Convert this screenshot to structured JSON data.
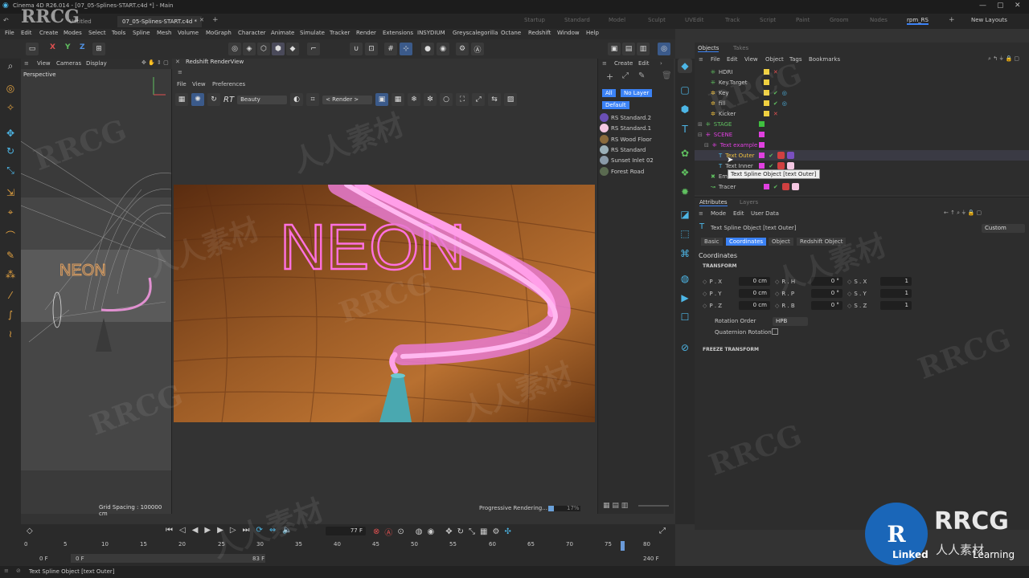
{
  "titlebar": {
    "title": "Cinema 4D R26.014 - [07_05-Splines-START.c4d *] - Main"
  },
  "file_tabs": [
    "Untitled",
    "07_05-Splines-START.c4d *"
  ],
  "layouts": [
    "Startup",
    "Standard",
    "Model",
    "Sculpt",
    "UVEdit",
    "Track",
    "Script",
    "Paint",
    "Groom",
    "Nodes",
    "rpm_RS"
  ],
  "new_layouts": "New Layouts",
  "menus": [
    "File",
    "Edit",
    "Create",
    "Modes",
    "Select",
    "Tools",
    "Spline",
    "Mesh",
    "Volume",
    "MoGraph",
    "Character",
    "Animate",
    "Simulate",
    "Tracker",
    "Render",
    "Extensions",
    "INSYDIUM",
    "Greyscalegorilla",
    "Octane",
    "Redshift",
    "Window",
    "Help"
  ],
  "axis": {
    "x": "X",
    "y": "Y",
    "z": "Z"
  },
  "viewport": {
    "menu": [
      "View",
      "Cameras",
      "Display"
    ],
    "label": "Perspective",
    "grid": "Grid Spacing : 100000 cm"
  },
  "renderview": {
    "title": "Redshift RenderView",
    "menu": [
      "File",
      "View",
      "Preferences"
    ],
    "rt": "RT",
    "aov": "Beauty",
    "render_dd": "< Render >",
    "neon_text": "NEON",
    "progress": "Progressive Rendering...",
    "progress_pct": "17%"
  },
  "materials": {
    "menu": [
      "Create",
      "Edit"
    ],
    "filters": [
      "All",
      "No Layer"
    ],
    "default_btn": "Default",
    "items": [
      {
        "name": "RS Standard.2",
        "color": "#6a4fb5"
      },
      {
        "name": "RS Standard.1",
        "color": "#f4c7e2"
      },
      {
        "name": "RS Wood Floor",
        "color": "#8a6a3c"
      },
      {
        "name": "RS Standard",
        "color": "#9bb0b8"
      },
      {
        "name": "Sunset Inlet 02",
        "color": "#8a9aa8"
      },
      {
        "name": "Forest Road",
        "color": "#5a6a50"
      }
    ]
  },
  "objects": {
    "tabs": [
      "Objects",
      "Takes"
    ],
    "menu": [
      "File",
      "Edit",
      "View",
      "Object",
      "Tags",
      "Bookmarks"
    ],
    "rows": [
      {
        "name": "HDRI",
        "color": "#f0d040",
        "indent": 0
      },
      {
        "name": "Key.Target",
        "color": "#f0d040",
        "indent": 0
      },
      {
        "name": "Key",
        "color": "#f0d040",
        "indent": 0
      },
      {
        "name": "fill",
        "color": "#f0d040",
        "indent": 0
      },
      {
        "name": "Kicker",
        "color": "#f0d040",
        "indent": 0
      },
      {
        "name": "STAGE",
        "color": "#40c040",
        "indent": 0
      },
      {
        "name": "SCENE",
        "color": "#e040e0",
        "indent": 0
      },
      {
        "name": "Text example",
        "color": "#e040e0",
        "indent": 1
      },
      {
        "name": "Text Outer",
        "color": "#e040e0",
        "indent": 2
      },
      {
        "name": "Text Inner",
        "color": "#e040e0",
        "indent": 2
      },
      {
        "name": "Emitter",
        "color": "#e040e0",
        "indent": 1
      },
      {
        "name": "Tracer",
        "color": "#e040e0",
        "indent": 1
      }
    ],
    "tooltip": "Text Spline Object [text Outer]"
  },
  "attributes": {
    "tabs": [
      "Attributes",
      "Layers"
    ],
    "menu": [
      "Mode",
      "Edit",
      "User Data"
    ],
    "object": "Text Spline Object [text Outer]",
    "preset": "Custom",
    "subtabs": [
      "Basic",
      "Coordinates",
      "Object",
      "Redshift Object"
    ],
    "section": "Coordinates",
    "group": "TRANSFORM",
    "rows": [
      {
        "p": "P . X",
        "pv": "0 cm",
        "r": "R . H",
        "rv": "0 °",
        "s": "S . X",
        "sv": "1"
      },
      {
        "p": "P . Y",
        "pv": "0 cm",
        "r": "R . P",
        "rv": "0 °",
        "s": "S . Y",
        "sv": "1"
      },
      {
        "p": "P . Z",
        "pv": "0 cm",
        "r": "R . B",
        "rv": "0 °",
        "s": "S . Z",
        "sv": "1"
      }
    ],
    "rotation_order_label": "Rotation Order",
    "rotation_order": "HPB",
    "quat_label": "Quaternion Rotation",
    "freeze": "FREEZE TRANSFORM"
  },
  "timeline": {
    "frame": "77 F",
    "ticks": [
      "0",
      "5",
      "10",
      "15",
      "20",
      "25",
      "30",
      "35",
      "40",
      "45",
      "50",
      "55",
      "60",
      "65",
      "70",
      "75",
      "80"
    ],
    "start": "0 F",
    "start2": "0 F",
    "mid": "83 F",
    "end": "240 F"
  },
  "status": "Text Spline Object [text Outer]",
  "watermark": {
    "rrcg": "RRCG",
    "cn": "人人素材",
    "linkedin": "Linked",
    "learning": "Learning"
  }
}
